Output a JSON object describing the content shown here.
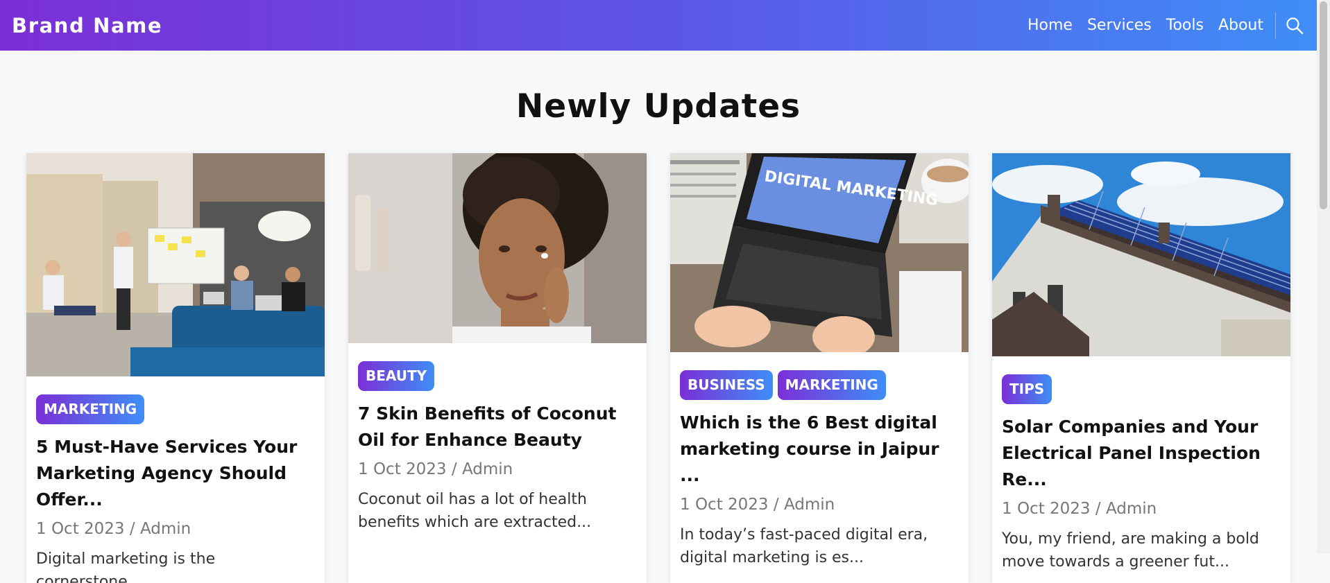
{
  "brand": "Brand Name",
  "nav": {
    "home": "Home",
    "services": "Services",
    "tools": "Tools",
    "about": "About"
  },
  "section_title": "Newly Updates",
  "cards": [
    {
      "tags": [
        "MARKETING"
      ],
      "title": "5 Must-Have Services Your Marketing Agency Should Offer...",
      "date": "1 Oct 2023",
      "separator": "/",
      "author": "Admin",
      "excerpt": "Digital marketing is the cornerstone..."
    },
    {
      "tags": [
        "BEAUTY"
      ],
      "title": "7 Skin Benefits of Coconut Oil for Enhance Beauty",
      "date": "1 Oct 2023",
      "separator": "/",
      "author": "Admin",
      "excerpt": "Coconut oil has a lot of health benefits which are extracted..."
    },
    {
      "tags": [
        "BUSINESS",
        "MARKETING"
      ],
      "title": "Which is the 6 Best digital marketing course in Jaipur ...",
      "date": "1 Oct 2023",
      "separator": "/",
      "author": "Admin",
      "excerpt": "In today’s fast-paced digital era, digital marketing is es..."
    },
    {
      "tags": [
        "TIPS"
      ],
      "title": "Solar Companies and Your Electrical Panel Inspection Re...",
      "date": "1 Oct 2023",
      "separator": "/",
      "author": "Admin",
      "excerpt": "You, my friend, are making a bold move towards a greener fut..."
    }
  ],
  "images": {
    "laptop_screen_text": "DIGITAL MARKETING"
  },
  "colors": {
    "gradient_start": "#7b2fd6",
    "gradient_end": "#3f8ef7",
    "background": "#f8f9fa"
  }
}
